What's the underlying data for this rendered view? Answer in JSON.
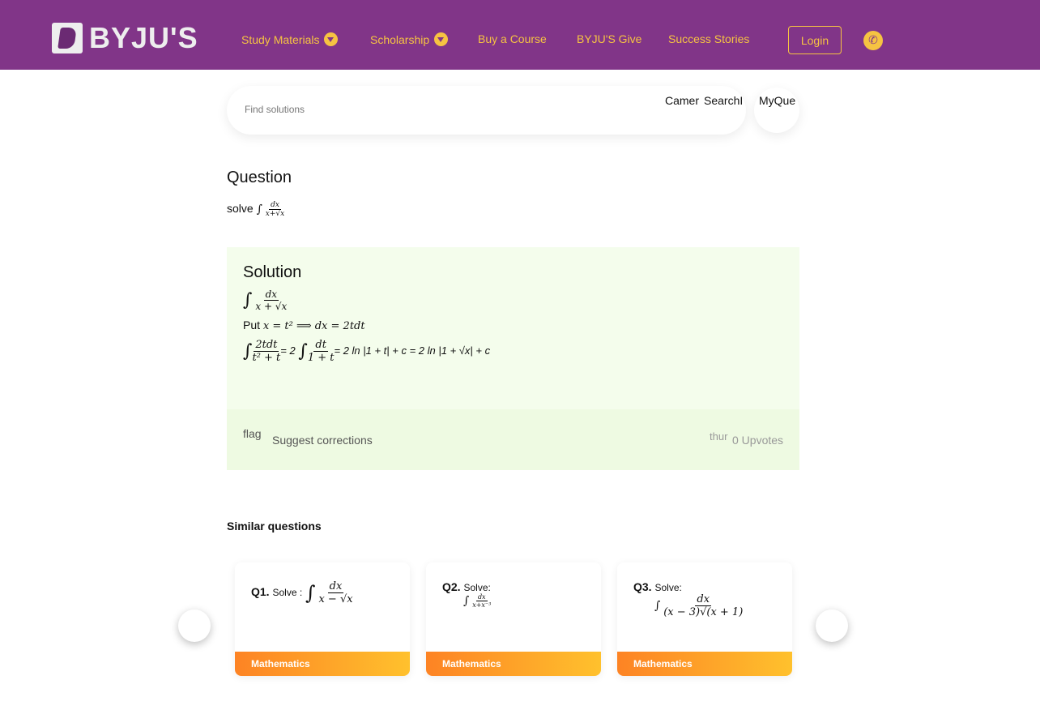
{
  "header": {
    "logo": "BYJU'S",
    "nav": [
      {
        "label": "Study Materials",
        "dropdown": true
      },
      {
        "label": "Scholarship",
        "dropdown": true
      },
      {
        "label": "Buy a Course"
      },
      {
        "label": "BYJU'S Give"
      },
      {
        "label": "Success Stories"
      }
    ],
    "login": "Login"
  },
  "search": {
    "placeholder": "Find solutions",
    "camera": "Camer",
    "search": "SearchI",
    "my_questions": "MyQue"
  },
  "question": {
    "heading": "Question",
    "prefix": "solve",
    "num": "dx",
    "den": "x+√x"
  },
  "solution": {
    "heading": "Solution",
    "l1_num": "dx",
    "l1_den": "x + √x",
    "l2_prefix": "Put",
    "l2_math": "x = t² ⟹ dx = 2tdt",
    "l3_num1": "2tdt",
    "l3_den1": "t² + t",
    "l3_mid": "= 2",
    "l3_num2": "dt",
    "l3_den2": "1 + t",
    "l3_tail": "= 2 ln |1 + t| + c = 2 ln |1 + √x| + c"
  },
  "feedback": {
    "flag": "flag",
    "suggest": "Suggest corrections",
    "thumb": "thur",
    "upvotes": "0 Upvotes"
  },
  "similar": {
    "heading": "Similar questions",
    "items": [
      {
        "num": "Q1.",
        "prefix": "Solve :",
        "numer": "dx",
        "denom": "x − √x",
        "subject": "Mathematics"
      },
      {
        "num": "Q2.",
        "prefix": "Solve:",
        "numer": "dx",
        "denom": "x+x⁻³",
        "subject": "Mathematics"
      },
      {
        "num": "Q3.",
        "prefix": "Solve:",
        "numer": "dx",
        "denom": "(x − 3)√(x + 1)",
        "subject": "Mathematics"
      }
    ]
  },
  "colors": {
    "header": "#813588",
    "accent": "#f6c342",
    "solution_bg": "#f4fdec"
  }
}
